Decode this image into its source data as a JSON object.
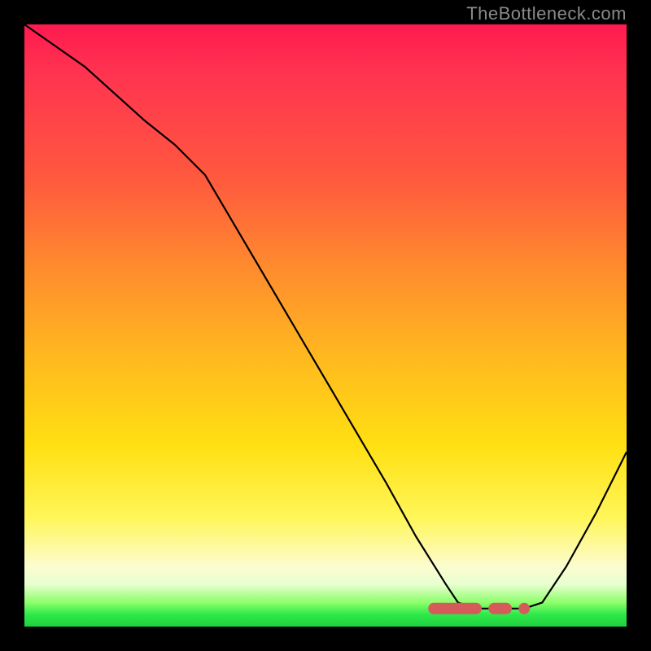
{
  "attribution": "TheBottleneck.com",
  "chart_data": {
    "type": "line",
    "title": "",
    "xlabel": "",
    "ylabel": "",
    "xlim": [
      0,
      100
    ],
    "ylim": [
      0,
      100
    ],
    "series": [
      {
        "name": "bottleneck-curve",
        "x": [
          0,
          10,
          20,
          25,
          30,
          40,
          50,
          60,
          65,
          70,
          72,
          75,
          78,
          80,
          83,
          86,
          90,
          95,
          100
        ],
        "values": [
          100,
          93,
          84,
          80,
          75,
          58,
          41,
          24,
          15,
          7,
          4,
          3,
          3,
          3,
          3,
          4,
          10,
          19,
          29
        ]
      }
    ],
    "highlight": {
      "name": "optimal-range",
      "segments_x": [
        [
          68,
          75
        ],
        [
          78,
          80
        ]
      ],
      "dots_x": [
        83
      ],
      "y": 3
    },
    "gradient_stops": [
      {
        "pos": 0.0,
        "color": "#ff1a4f"
      },
      {
        "pos": 0.26,
        "color": "#ff5a3e"
      },
      {
        "pos": 0.55,
        "color": "#ffb81f"
      },
      {
        "pos": 0.82,
        "color": "#fff65a"
      },
      {
        "pos": 0.96,
        "color": "#8cff6a"
      },
      {
        "pos": 1.0,
        "color": "#1fd13d"
      }
    ]
  }
}
